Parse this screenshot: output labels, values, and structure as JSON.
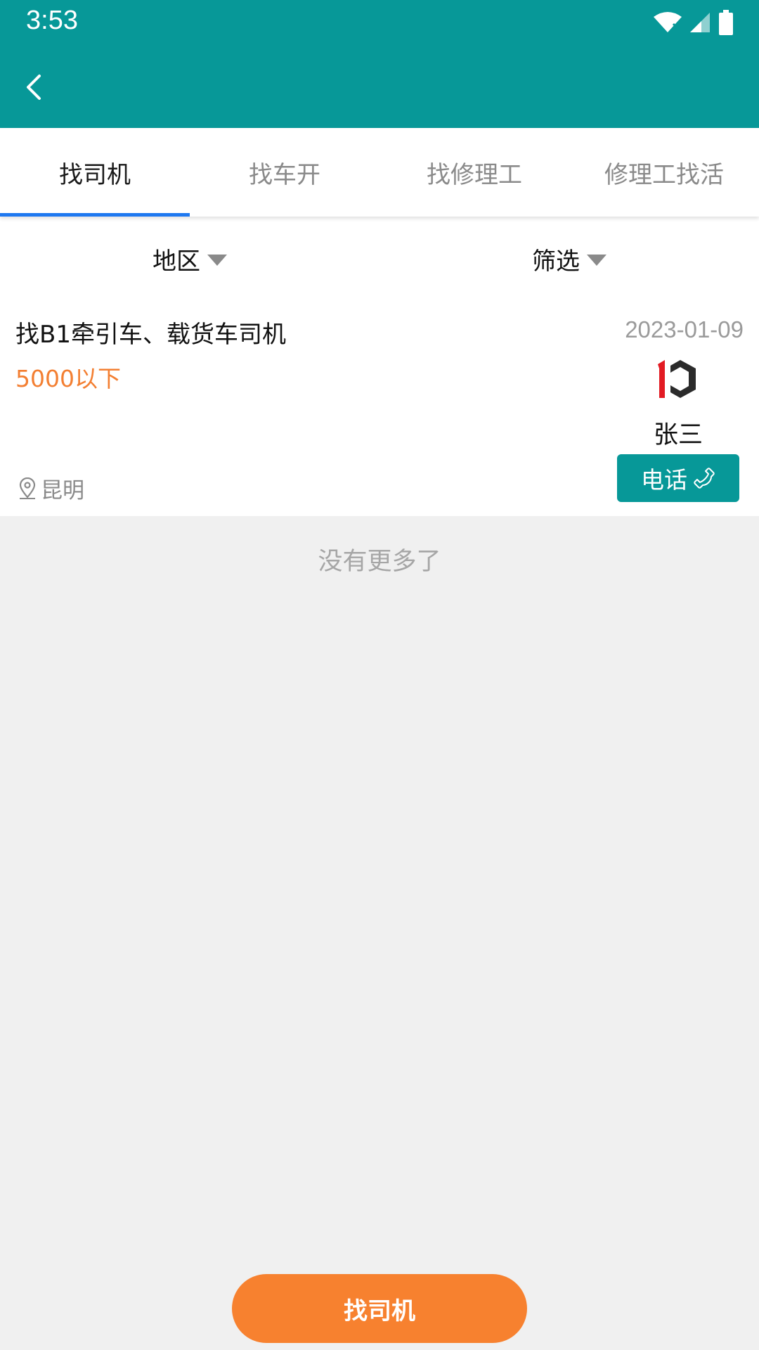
{
  "status_bar": {
    "time": "3:53",
    "icons": [
      "wifi-icon",
      "signal-icon",
      "battery-icon"
    ]
  },
  "app_bar": {
    "back_icon": "chevron-left-icon",
    "background_color": "#079898"
  },
  "tabs": [
    {
      "label": "找司机",
      "active": true
    },
    {
      "label": "找车开",
      "active": false
    },
    {
      "label": "找修理工",
      "active": false
    },
    {
      "label": "修理工找活",
      "active": false
    }
  ],
  "filters": {
    "region_label": "地区",
    "filter_label": "筛选"
  },
  "listing": {
    "title": "找B1牵引车、载货车司机",
    "salary": "5000以下",
    "date": "2023-01-09",
    "poster_name": "张三",
    "location": "昆明",
    "call_label": "电话",
    "avatar_logo_text": "1C"
  },
  "list_footer": "没有更多了",
  "bottom_button_label": "找司机",
  "colors": {
    "primary": "#079898",
    "accent_orange": "#f7812f",
    "tab_indicator": "#1e78f0",
    "salary_text": "#f37f32"
  }
}
